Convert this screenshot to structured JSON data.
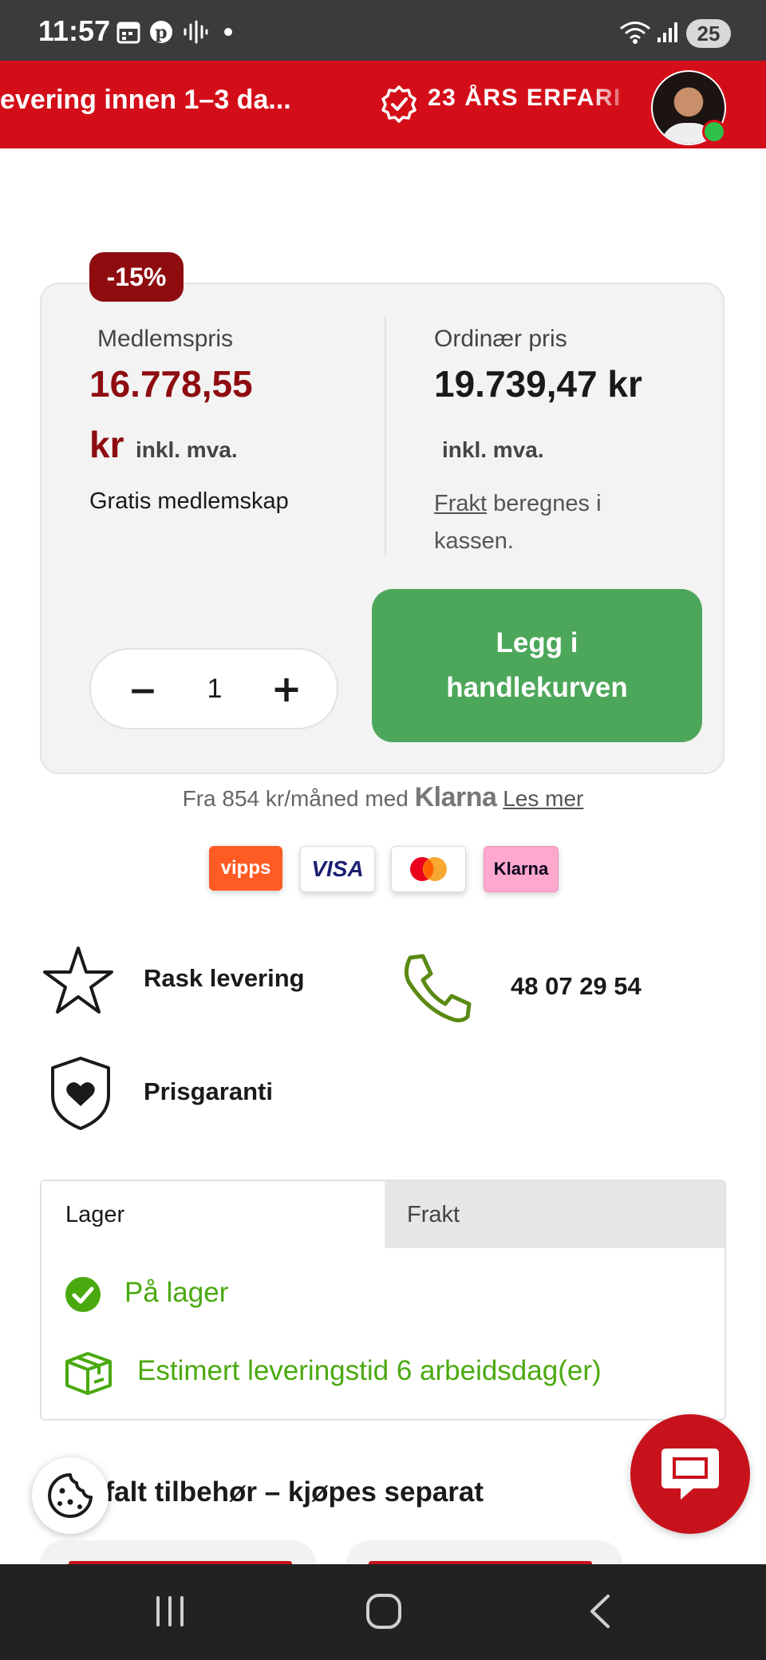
{
  "status_bar": {
    "time": "11:57",
    "battery": "25"
  },
  "banner": {
    "marquee_left": "evering innen 1–3 da...",
    "marquee_right": "23 ÅRS ERFARI"
  },
  "price_card": {
    "discount_badge": "-15%",
    "member": {
      "label": "Medlemspris",
      "price": "16.778,55",
      "currency": "kr",
      "vat": "inkl. mva.",
      "note": "Gratis medlemskap"
    },
    "ordinary": {
      "label": "Ordinær pris",
      "price": "19.739,47 kr",
      "vat": "inkl. mva.",
      "shipping_link": "Frakt",
      "shipping_text": "beregnes i kassen."
    },
    "quantity": {
      "minus": "−",
      "value": "1",
      "plus": "+"
    },
    "add_to_cart": "Legg i handlekurven"
  },
  "klarna_line": {
    "prefix": "Fra 854 kr/måned med",
    "brand": "Klarna",
    "link": "Les mer"
  },
  "payment_methods": [
    {
      "name": "vipps",
      "bg": "#ff5b24",
      "fg": "#ffffff"
    },
    {
      "name": "VISA",
      "bg": "#ffffff",
      "fg": "#1a1f71"
    },
    {
      "name": "mastercard",
      "bg": "#ffffff",
      "fg": "#000000"
    },
    {
      "name": "Klarna",
      "bg": "#ffa8cd",
      "fg": "#0b051d"
    }
  ],
  "features": {
    "fast_delivery": "Rask levering",
    "phone": "48 07 29 54",
    "price_guarantee": "Prisgaranti"
  },
  "tabs": {
    "lager": "Lager",
    "frakt": "Frakt",
    "stock_status": "På lager",
    "delivery_estimate": "Estimert leveringstid 6 arbeidsdag(er)"
  },
  "accessories_title": "efalt tilbehør – kjøpes separat",
  "colors": {
    "brand_red": "#d40e19",
    "dark_red": "#8e0c10",
    "cta_green": "#4da75a",
    "stock_green": "#4aa90f"
  }
}
